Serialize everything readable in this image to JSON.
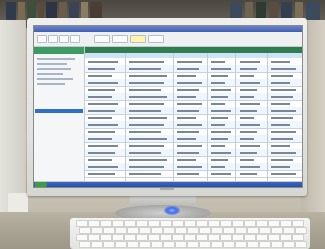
{
  "app": {
    "window_title": "",
    "bezel_text": ""
  },
  "colors": {
    "titlebar": "#3f5fb3",
    "grid_header": "#2f7d4f",
    "sidebar_header": "#3c9a63",
    "taskbar": "#2a4ea3",
    "power_led": "#3e6cf2"
  },
  "icons": {
    "start": "start-button-icon",
    "power": "power-led-icon"
  }
}
